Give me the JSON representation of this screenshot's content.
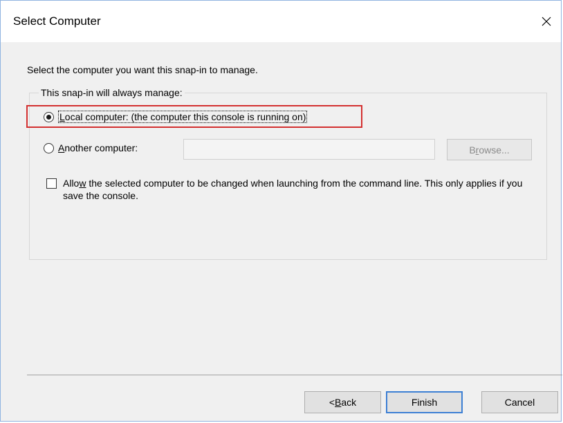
{
  "window": {
    "title": "Select Computer",
    "close_icon": "close-icon"
  },
  "prompt": "Select the computer you want this snap-in to manage.",
  "group": {
    "legend": "This snap-in will always manage:",
    "local_option": {
      "mnemonic": "L",
      "rest": "ocal computer:  (the computer this console is running on)",
      "selected": true
    },
    "another_option": {
      "mnemonic": "A",
      "rest": "nother computer:",
      "selected": false
    },
    "computer_input": {
      "value": "",
      "placeholder": ""
    },
    "browse": {
      "prefix": "B",
      "mnemonic": "r",
      "rest": "owse..."
    },
    "allow_checkbox": {
      "prefix": "Allo",
      "mnemonic": "w",
      "rest": " the selected computer to be changed when launching from the command line.  This only applies if you save the console.",
      "checked": false
    }
  },
  "buttons": {
    "back": {
      "prefix": "< ",
      "mnemonic": "B",
      "rest": "ack"
    },
    "finish": "Finish",
    "cancel": "Cancel"
  },
  "colors": {
    "highlight": "#d32f2f",
    "default_button_border": "#3c7fd4"
  }
}
